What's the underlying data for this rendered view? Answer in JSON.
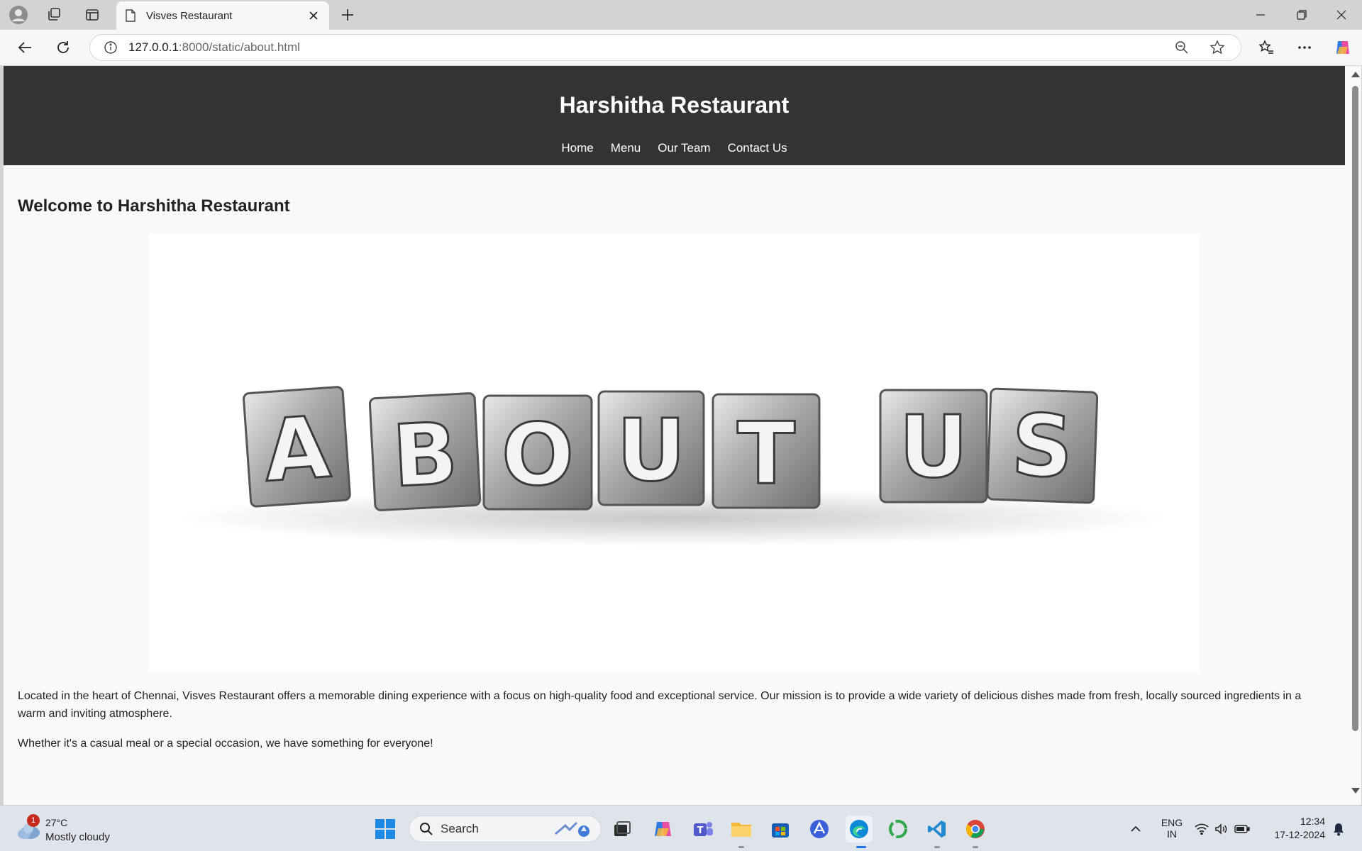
{
  "browser": {
    "tab_title": "Visves Restaurant",
    "url_host": "127.0.0.1",
    "url_rest": ":8000/static/about.html"
  },
  "page": {
    "site_title": "Harshitha Restaurant",
    "nav": [
      "Home",
      "Menu",
      "Our Team",
      "Contact Us"
    ],
    "welcome_heading": "Welcome to Harshitha Restaurant",
    "image_letters": [
      "A",
      "B",
      "O",
      "U",
      "T",
      "U",
      "S"
    ],
    "paragraph1": "Located in the heart of Chennai, Visves Restaurant offers a memorable dining experience with a focus on high-quality food and exceptional service. Our mission is to provide a wide variety of delicious dishes made from fresh, locally sourced ingredients in a warm and inviting atmosphere.",
    "paragraph2": "Whether it's a casual meal or a special occasion, we have something for everyone!"
  },
  "taskbar": {
    "weather_temp": "27°C",
    "weather_condition": "Mostly cloudy",
    "weather_badge": "1",
    "search_label": "Search",
    "lang_top": "ENG",
    "lang_bottom": "IN",
    "time": "12:34",
    "date": "17-12-2024"
  },
  "colors": {
    "header_bg": "#333333",
    "page_bg": "#f9f9f9"
  }
}
